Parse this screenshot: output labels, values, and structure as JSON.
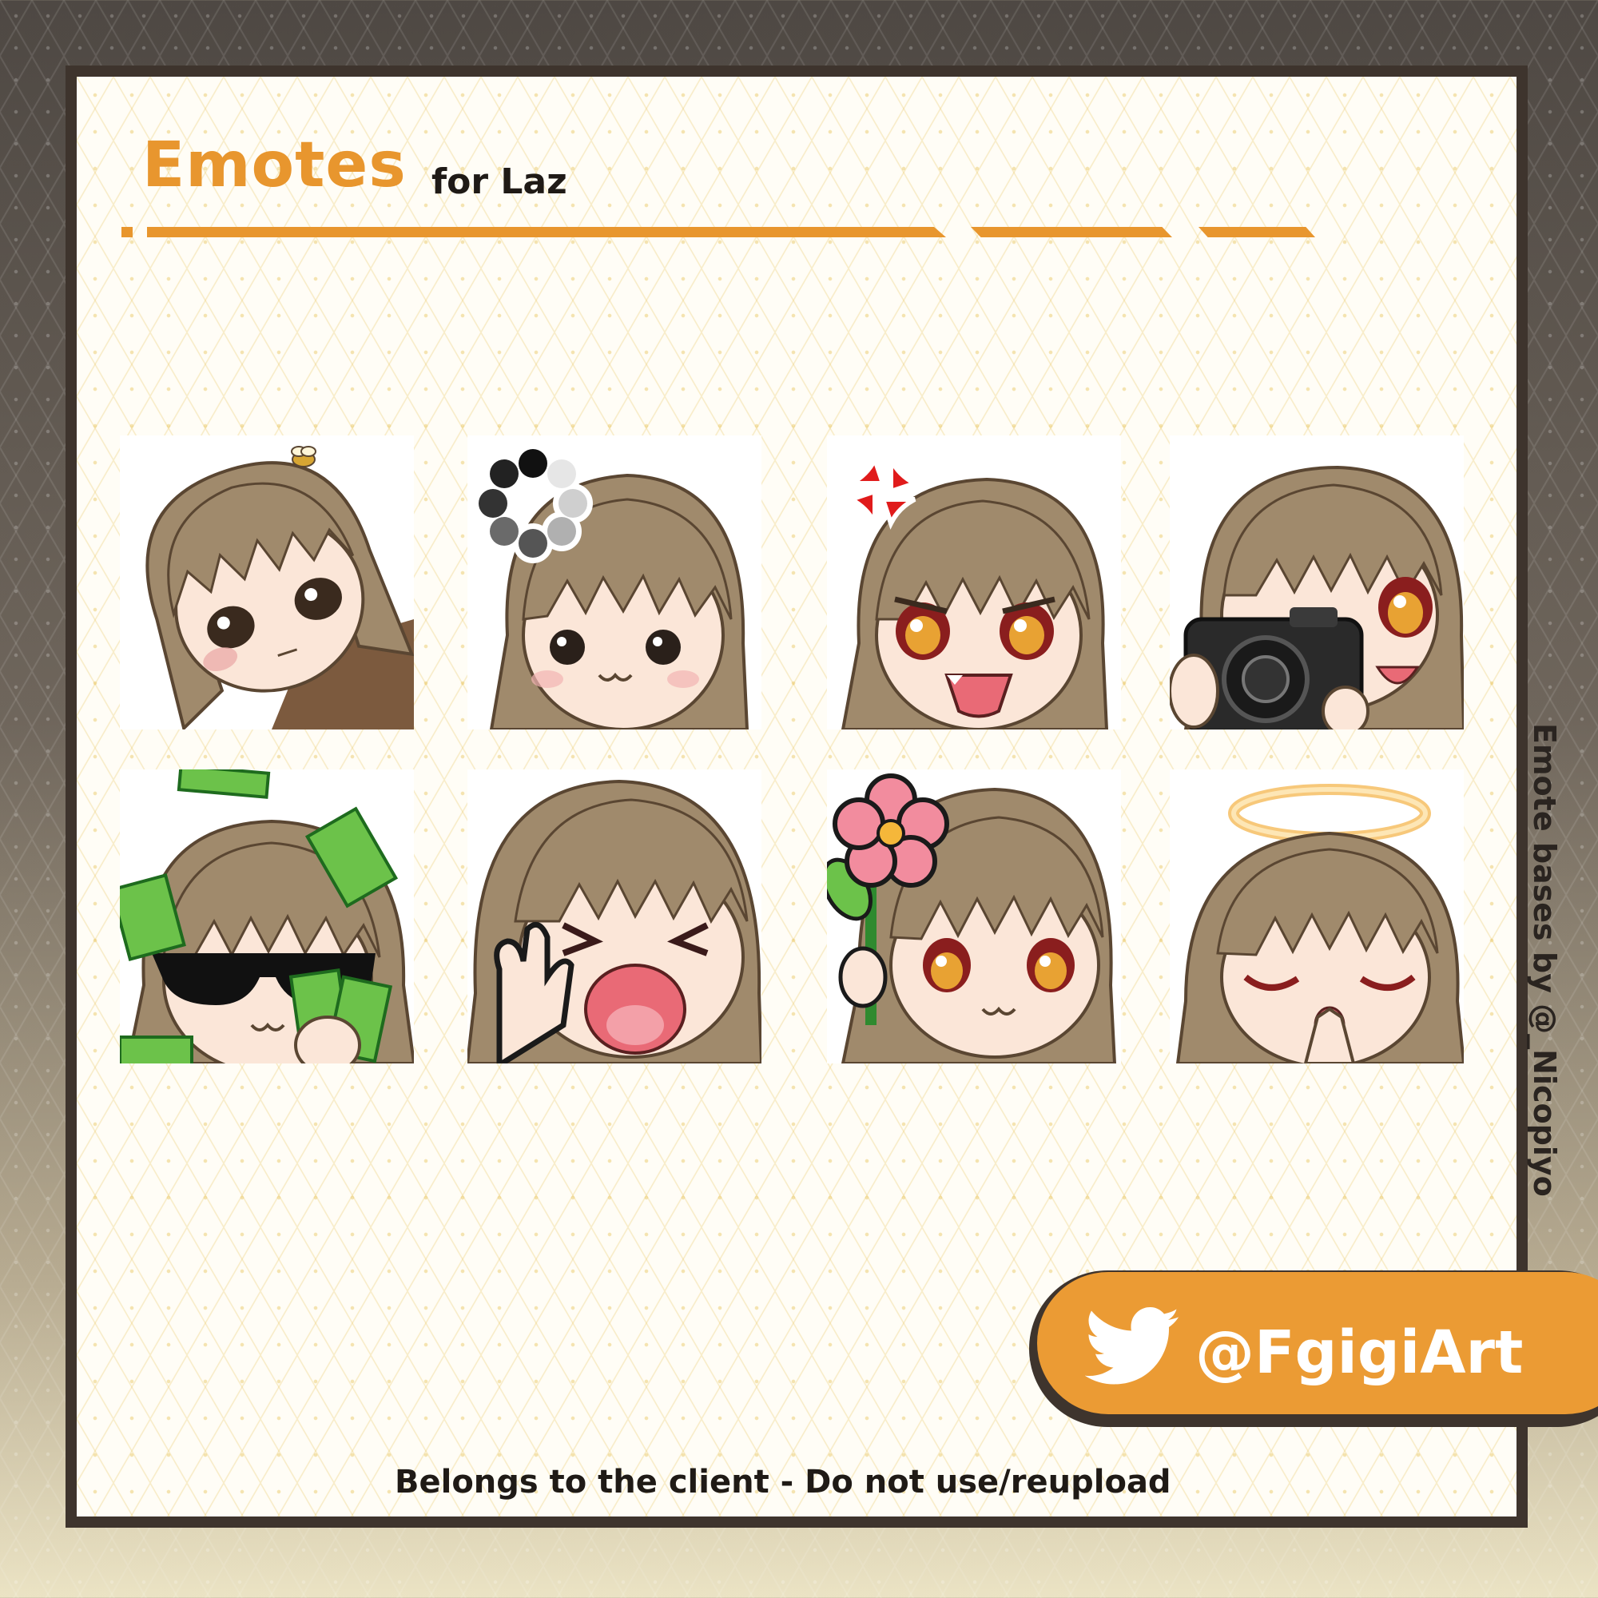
{
  "header": {
    "title": "Emotes",
    "subtitle": "for Laz"
  },
  "emotes": [
    {
      "name": "tilt-pout",
      "icon": "character-tilt-head-icon"
    },
    {
      "name": "loading",
      "icon": "character-loading-spinner-icon"
    },
    {
      "name": "angry",
      "icon": "character-anger-mark-icon"
    },
    {
      "name": "camera",
      "icon": "character-camera-icon"
    },
    {
      "name": "money",
      "icon": "character-sunglasses-money-icon"
    },
    {
      "name": "laugh-wave",
      "icon": "character-laugh-wave-icon"
    },
    {
      "name": "flower",
      "icon": "character-flower-icon"
    },
    {
      "name": "pray",
      "icon": "character-halo-pray-icon"
    }
  ],
  "side_credit": "Emote bases by @_Nicopiyo",
  "social": {
    "icon": "twitter-bird-icon",
    "handle": "@FgigiArt"
  },
  "footer_note": "Belongs to the client - Do not use/reupload",
  "colors": {
    "accent": "#e8962e",
    "pill": "#eb9b34",
    "frame": "#3e342d",
    "hair": "#a08a6c",
    "skin": "#fbe6d8"
  }
}
